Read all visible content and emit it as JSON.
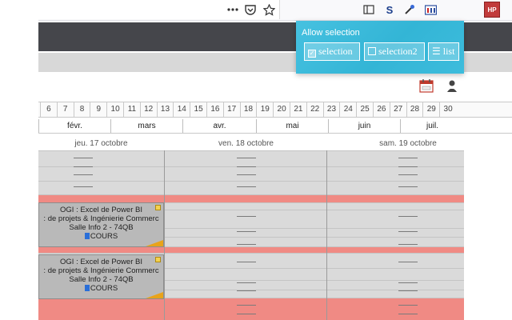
{
  "toolbar": {
    "icons": [
      "more-menu-icon",
      "pocket-icon",
      "bookmark-star-icon",
      "reader-view-icon",
      "s-extension-icon",
      "eyedropper-icon",
      "library-icon",
      "hp-extension-icon"
    ],
    "s_label": "S",
    "hp_label": "HP"
  },
  "popup": {
    "title": "Allow selection",
    "buttons": [
      {
        "label": "selection",
        "checked": true
      },
      {
        "label": "selection2",
        "checked": false
      },
      {
        "label": "list",
        "icon": "list-icon"
      }
    ],
    "check_mark": "✓",
    "list_glyph": "☰"
  },
  "timeline": {
    "days": [
      "6",
      "7",
      "8",
      "9",
      "10",
      "11",
      "12",
      "13",
      "14",
      "15",
      "16",
      "17",
      "18",
      "19",
      "20",
      "21",
      "22",
      "23",
      "24",
      "25",
      "26",
      "27",
      "28",
      "29",
      "30"
    ],
    "months": [
      "févr.",
      "mars",
      "avr.",
      "mai",
      "juin",
      "juil."
    ]
  },
  "columns": [
    "jeu. 17 octobre",
    "ven. 18 octobre",
    "sam. 19 octobre"
  ],
  "events": [
    {
      "title": "OGI : Excel de Power BI",
      "course": ": de projets & Ingénierie Commerc",
      "room": "Salle Info 2 - 74QB",
      "type": "COURS"
    },
    {
      "title": "OGI : Excel de Power BI",
      "course": ": de projets & Ingénierie Commerc",
      "room": "Salle Info 2 - 74QB",
      "type": "COURS"
    }
  ],
  "colors": {
    "popup": "#3dbcdc",
    "dark_header": "#45464b",
    "unavailable": "#f08a84",
    "event": "#b9b9b9",
    "course_badge": "#2a6fd8"
  }
}
